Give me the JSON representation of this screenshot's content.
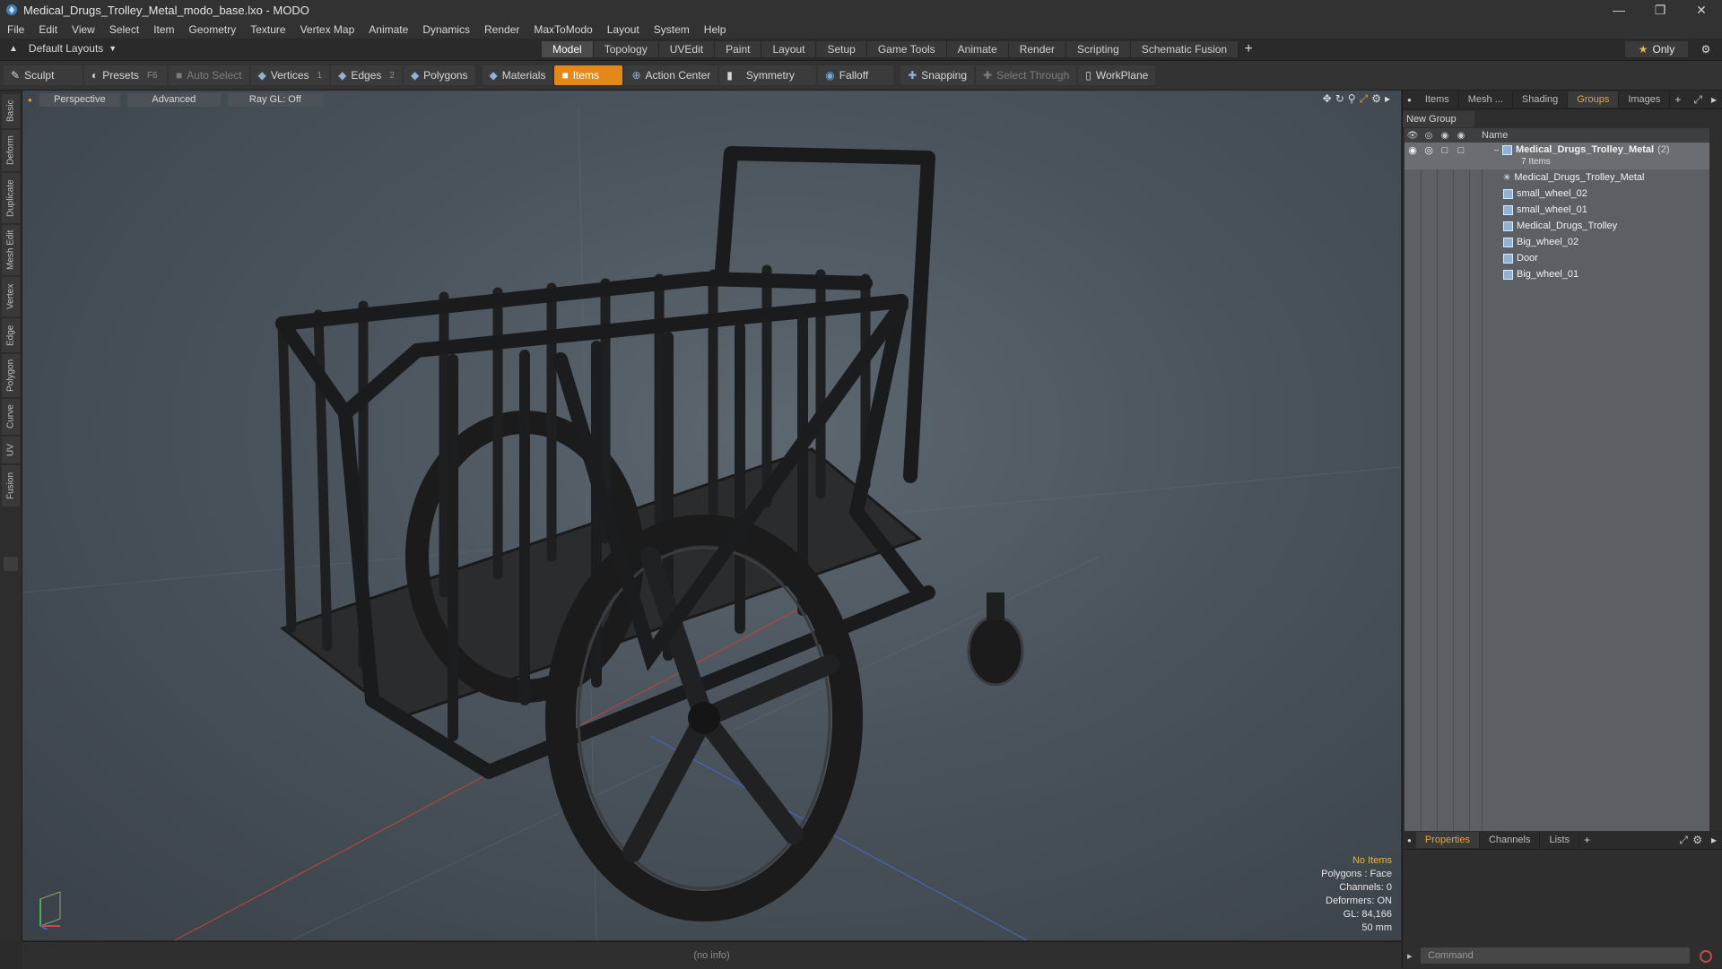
{
  "window": {
    "title": "Medical_Drugs_Trolley_Metal_modo_base.lxo - MODO",
    "controls": [
      "minimize-icon",
      "restore-icon",
      "close-icon"
    ]
  },
  "menu": [
    "File",
    "Edit",
    "View",
    "Select",
    "Item",
    "Geometry",
    "Texture",
    "Vertex Map",
    "Animate",
    "Dynamics",
    "Render",
    "MaxToModo",
    "Layout",
    "System",
    "Help"
  ],
  "layouts": {
    "label": "Default Layouts"
  },
  "tabs": [
    {
      "label": "Model",
      "active": true
    },
    {
      "label": "Topology"
    },
    {
      "label": "UVEdit"
    },
    {
      "label": "Paint"
    },
    {
      "label": "Layout"
    },
    {
      "label": "Setup"
    },
    {
      "label": "Game Tools"
    },
    {
      "label": "Animate"
    },
    {
      "label": "Render"
    },
    {
      "label": "Scripting"
    },
    {
      "label": "Schematic Fusion"
    }
  ],
  "only_label": "Only",
  "toolbar": {
    "sculpt": "Sculpt",
    "presets": "Presets",
    "presets_key": "F6",
    "auto_select": "Auto Select",
    "vertices": "Vertices",
    "vertices_num": "1",
    "edges": "Edges",
    "edges_num": "2",
    "polygons": "Polygons",
    "materials": "Materials",
    "items": "Items",
    "action_center": "Action Center",
    "symmetry": "Symmetry",
    "falloff": "Falloff",
    "snapping": "Snapping",
    "select_through": "Select Through",
    "workplane": "WorkPlane"
  },
  "left_tabs": [
    "Basic",
    "Deform",
    "Duplicate",
    "Mesh Edit",
    "Vertex",
    "Edge",
    "Polygon",
    "Curve",
    "UV",
    "Fusion"
  ],
  "viewport": {
    "perspective": "Perspective",
    "advanced": "Advanced",
    "raygl": "Ray GL: Off",
    "info": {
      "no_items": "No Items",
      "polygons": "Polygons : Face",
      "channels": "Channels: 0",
      "deformers": "Deformers: ON",
      "gl": "GL: 84,166",
      "scale": "50 mm"
    }
  },
  "status": "(no info)",
  "right_panel": {
    "tabs": [
      "Items",
      "Mesh ...",
      "Shading",
      "Groups",
      "Images"
    ],
    "active_tab": "Groups",
    "new_group": "New Group",
    "name_col": "Name",
    "group": {
      "name": "Medical_Drugs_Trolley_Metal",
      "count": "(2)",
      "sub": "7 Items"
    },
    "items": [
      "Medical_Drugs_Trolley_Metal",
      "small_wheel_02",
      "small_wheel_01",
      "Medical_Drugs_Trolley",
      "Big_wheel_02",
      "Door",
      "Big_wheel_01"
    ],
    "bottom_tabs": [
      "Properties",
      "Channels",
      "Lists"
    ],
    "command_placeholder": "Command"
  },
  "colors": {
    "accent": "#e3891c",
    "tab_active_text": "#e9a23b",
    "info_highlight": "#e9b44c"
  }
}
